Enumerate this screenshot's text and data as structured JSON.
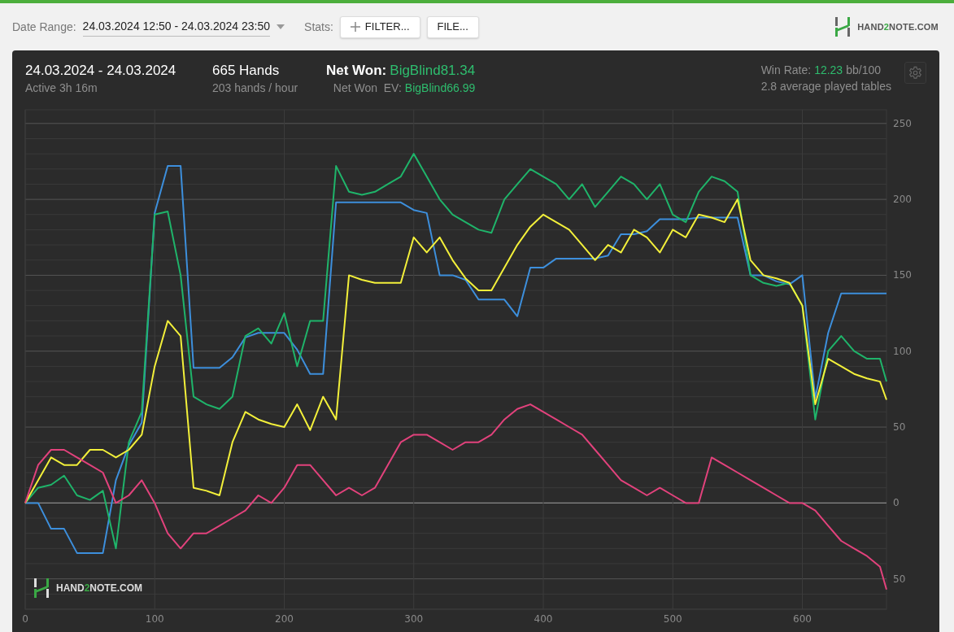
{
  "toolbar": {
    "date_range_label": "Date Range:",
    "date_range_value": "24.03.2024 12:50 - 24.03.2024 23:50",
    "stats_label": "Stats:",
    "buttons": [
      {
        "kind": "add",
        "label": "FILTER..."
      },
      {
        "kind": "plain",
        "label": "FILE..."
      }
    ],
    "logo": {
      "before": "HAND",
      "accent": "2",
      "after": "NOTE.COM"
    }
  },
  "summary": {
    "date_span": "24.03.2024 - 24.03.2024",
    "active": "Active 3h 16m",
    "hands": "665 Hands",
    "hands_rate": "203 hands / hour",
    "net_won_label": "Net Won:",
    "net_won_value": "BigBlind81.34",
    "net_won_ev_label": "Net Won  EV:",
    "net_won_ev_value": "BigBlind66.99",
    "win_rate_label": "Win Rate:",
    "win_rate_value": "12.23",
    "win_rate_unit": "bb/100",
    "tables": "2.8 average played tables"
  },
  "chart": {
    "watermark": {
      "before": "HAND",
      "accent": "2",
      "after": "NOTE.COM"
    },
    "chart_data": {
      "type": "line",
      "grid": true,
      "xlim": [
        0,
        665
      ],
      "ylim": [
        -70,
        259
      ],
      "xticks": [
        0,
        100,
        200,
        300,
        400,
        500,
        600
      ],
      "yticks": [
        {
          "value": -50,
          "label": "50"
        },
        0,
        50,
        100,
        150,
        200,
        250
      ],
      "x": [
        0,
        10,
        20,
        30,
        40,
        50,
        60,
        70,
        80,
        90,
        100,
        110,
        120,
        130,
        140,
        150,
        160,
        170,
        180,
        190,
        200,
        210,
        220,
        230,
        240,
        250,
        260,
        270,
        280,
        290,
        300,
        310,
        320,
        330,
        340,
        350,
        360,
        370,
        380,
        390,
        400,
        410,
        420,
        430,
        440,
        450,
        460,
        470,
        480,
        490,
        500,
        510,
        520,
        530,
        540,
        550,
        560,
        570,
        580,
        590,
        600,
        610,
        620,
        630,
        640,
        650,
        660,
        665
      ],
      "series": [
        {
          "color": "#3d8fdc",
          "values": [
            0,
            0,
            -17,
            -17,
            -33,
            -33,
            -33,
            15,
            38,
            53,
            191,
            222,
            222,
            89,
            89,
            89,
            96,
            109,
            112,
            112,
            112,
            101,
            85,
            85,
            198,
            198,
            198,
            198,
            198,
            198,
            193,
            191,
            150,
            150,
            147,
            134,
            134,
            134,
            123,
            155,
            155,
            161,
            161,
            161,
            161,
            163,
            177,
            177,
            179,
            187,
            187,
            187,
            188,
            188,
            188,
            188,
            150,
            150,
            146,
            144,
            150,
            69,
            112,
            138,
            138,
            138,
            138,
            138
          ]
        },
        {
          "color": "#1fb46a",
          "values": [
            0,
            10,
            12,
            18,
            5,
            2,
            8,
            -30,
            40,
            60,
            190,
            192,
            150,
            70,
            65,
            62,
            70,
            110,
            115,
            105,
            125,
            90,
            120,
            120,
            222,
            205,
            203,
            205,
            210,
            215,
            230,
            215,
            200,
            190,
            185,
            180,
            178,
            200,
            210,
            220,
            215,
            210,
            200,
            210,
            195,
            205,
            215,
            210,
            200,
            210,
            190,
            185,
            205,
            215,
            212,
            205,
            150,
            145,
            143,
            145,
            130,
            55,
            100,
            110,
            100,
            95,
            95,
            80
          ]
        },
        {
          "color": "#f3f03a",
          "values": [
            0,
            15,
            30,
            25,
            25,
            35,
            35,
            30,
            35,
            45,
            90,
            120,
            110,
            10,
            8,
            5,
            40,
            60,
            55,
            52,
            50,
            65,
            48,
            70,
            55,
            150,
            147,
            145,
            145,
            145,
            175,
            165,
            175,
            160,
            148,
            140,
            140,
            155,
            170,
            182,
            190,
            185,
            180,
            170,
            160,
            170,
            165,
            180,
            175,
            165,
            180,
            175,
            190,
            188,
            185,
            200,
            160,
            150,
            148,
            145,
            130,
            65,
            95,
            90,
            85,
            82,
            80,
            68
          ]
        },
        {
          "color": "#e2427c",
          "values": [
            0,
            25,
            35,
            35,
            30,
            25,
            20,
            0,
            5,
            15,
            0,
            -20,
            -30,
            -20,
            -20,
            -15,
            -10,
            -5,
            5,
            0,
            10,
            25,
            25,
            15,
            5,
            10,
            5,
            10,
            25,
            40,
            45,
            45,
            40,
            35,
            40,
            40,
            45,
            55,
            62,
            65,
            60,
            55,
            50,
            45,
            35,
            25,
            15,
            10,
            5,
            10,
            5,
            0,
            0,
            30,
            25,
            20,
            15,
            10,
            5,
            0,
            0,
            -5,
            -15,
            -25,
            -30,
            -35,
            -42,
            -57
          ]
        }
      ]
    }
  }
}
